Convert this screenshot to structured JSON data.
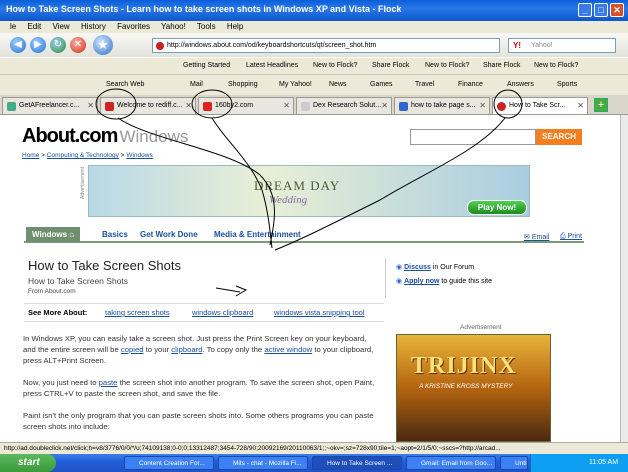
{
  "window": {
    "title": "How to Take Screen Shots - Learn how to take screen shots in Windows XP and Vista - Flock",
    "min": "_",
    "max": "□",
    "close": "✕"
  },
  "menu": [
    "le",
    "Edit",
    "View",
    "History",
    "Favorites",
    "Yahoo!",
    "Tools",
    "Help"
  ],
  "nav": {
    "url": "http://windows.about.com/od/keyboardshortcuts/qt/screen_shot.htm",
    "search_placeholder": "Yahoo!"
  },
  "bookmarks": [
    "Getting Started",
    "Latest Headlines",
    "New to Flock?",
    "Share Flock",
    "New to Flock?",
    "Share Flock",
    "New to Flock?"
  ],
  "toolbar": [
    "Search Web",
    "Mail",
    "Shopping",
    "My Yahoo!",
    "News",
    "Games",
    "Travel",
    "Finance",
    "Answers",
    "Sports"
  ],
  "tabs": [
    "GetAFreelancer.c...",
    "Welcome to rediff.c...",
    "160by2.com",
    "Dex Research Solut...",
    "how to take page s...",
    "How to Take Scr..."
  ],
  "site": {
    "logo": "About.com",
    "section": "Windows",
    "breadcrumb": [
      "Home",
      "Computing & Technology",
      "Windows"
    ],
    "search_btn": "SEARCH",
    "ad_label": "Advertisement",
    "banner_title": "DREAM DAY",
    "banner_sub": "Wedding",
    "banner_cta": "Play Now!",
    "tabs": [
      "Windows",
      "Basics",
      "Get Work Done",
      "Media & Entertainment"
    ],
    "email": "Email",
    "print": "Print",
    "title": "How to Take Screen Shots",
    "subtitle": "How to Take Screen Shots",
    "from": "From About.com",
    "discuss": "Discuss",
    "discuss_rest": " in Our Forum",
    "apply": "Apply now",
    "apply_rest": " to guide this site",
    "see_more": "See More About:",
    "see_links": [
      "taking screen shots",
      "windows clipboard",
      "windows vista snipping tool"
    ],
    "p1a": "In Windows XP, you can easily take a screen shot. Just press the Print Screen key on your keyboard, and the entire screen will be ",
    "p1b": "copied",
    "p1c": " to your ",
    "p1d": "clipboard",
    "p1e": ". To copy only the ",
    "p1f": "active window",
    "p1g": " to your clipboard, press ALT+Print Screen.",
    "p2a": "Now, you just need to ",
    "p2b": "paste",
    "p2c": " the screen shot into another program. To save the screen shot, open Paint, press CTRL+V to paste the screen shot, and save the file.",
    "p3": "Paint isn't the only program that you can paste screen shots into. Some others programs you can paste screen shots into include:",
    "ad2": "Advertisement",
    "game": "TRIJINX",
    "game_sub": "A KRISTINE KROSS MYSTERY"
  },
  "status": "http://ad.doubleclick.net/click;h=v8/3776/0/0/*/u;74109138;0-0;0;13312487;3454-728/90;20092169/20110063/1;;~okv=;sz=728x90;tile=1;~aopt=2/1/5/0;~sscs=?http://arcad...",
  "taskbar": {
    "start": "start",
    "items": [
      "Content Creation For...",
      "Mits - chat - Mozilla Fi...",
      "How to Take Screen ...",
      "Gmail: Email from Goo...",
      "Untitled - Paint"
    ],
    "time": "11:05 AM"
  }
}
